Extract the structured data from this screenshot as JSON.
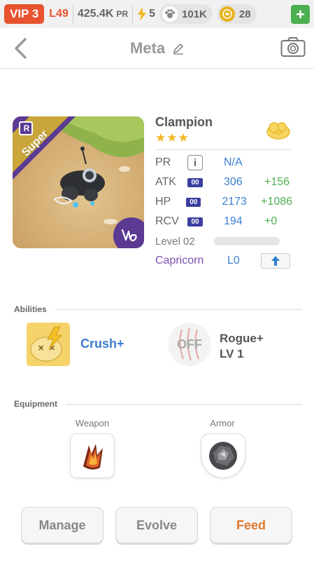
{
  "status": {
    "vip": "VIP 3",
    "level": "L49",
    "pr_value": "425.4K",
    "pr_unit": "PR",
    "energy": "5",
    "paws": "101K",
    "coins": "28",
    "plus": "+"
  },
  "header": {
    "title": "Meta"
  },
  "monster": {
    "name": "Clampion",
    "stars": "★★★",
    "rank_badge": "R",
    "grade": "Super",
    "stats": [
      {
        "label": "PR",
        "value": "N/A",
        "bonus": ""
      },
      {
        "label": "ATK",
        "badge": "00",
        "value": "306",
        "bonus": "+156"
      },
      {
        "label": "HP",
        "badge": "00",
        "value": "2173",
        "bonus": "+1086"
      },
      {
        "label": "RCV",
        "badge": "00",
        "value": "194",
        "bonus": "+0"
      }
    ],
    "level": "Level 02",
    "level_progress": 0,
    "zodiac": "Capricorn",
    "zodiac_level": "L0",
    "info_icon": "i"
  },
  "abilities": {
    "title": "Abilities",
    "items": [
      {
        "name": "Crush+",
        "icon": "crush-icon"
      },
      {
        "name": "Rogue+",
        "level": "LV 1",
        "state": "OFF",
        "icon": "claw-icon"
      }
    ]
  },
  "equipment": {
    "title": "Equipment",
    "weapon_label": "Weapon",
    "armor_label": "Armor"
  },
  "actions": {
    "manage": "Manage",
    "evolve": "Evolve",
    "feed": "Feed"
  },
  "colors": {
    "accent": "#e8532f",
    "stat_value": "#3b7fd0",
    "bonus": "#4caf50",
    "zodiac": "#7a4fb0",
    "feed": "#e07a2e"
  }
}
